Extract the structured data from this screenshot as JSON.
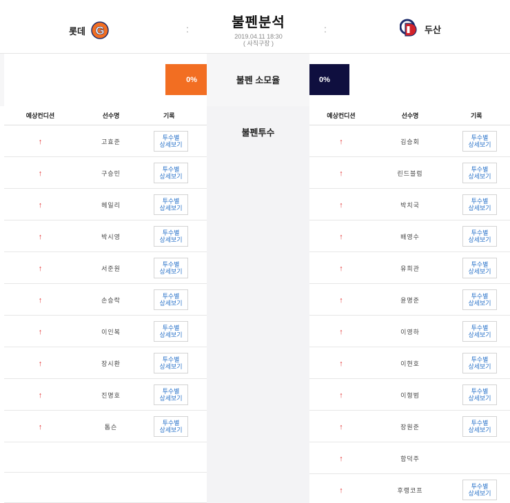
{
  "header": {
    "title": "불펜분석",
    "datetime": "2019.04.11 18:30",
    "venue": "( 사직구장 )",
    "separator": ":",
    "home": {
      "name": "롯데",
      "logo_letter": "G",
      "logo_color": "#f26e22"
    },
    "away": {
      "name": "두산",
      "logo_letter": "D",
      "logo_color": "#d3232a",
      "logo_color2": "#1c2b6b"
    }
  },
  "exhaustion": {
    "label": "불펜 소모율",
    "home_pct": "0%",
    "away_pct": "0%",
    "home_color": "#f26e22",
    "away_color": "#0f0f3f"
  },
  "center": {
    "title": "불펜투수"
  },
  "columns": {
    "condition": "예상컨디션",
    "player": "선수명",
    "record": "기록"
  },
  "detail_label_line1": "투수별",
  "detail_label_line2": "상세보기",
  "condition_arrow": "↑",
  "home_players": [
    {
      "name": "고효준"
    },
    {
      "name": "구승민"
    },
    {
      "name": "헤일리"
    },
    {
      "name": "박시영"
    },
    {
      "name": "서준원"
    },
    {
      "name": "손승락"
    },
    {
      "name": "이인복"
    },
    {
      "name": "장시환"
    },
    {
      "name": "진명호"
    },
    {
      "name": "톰슨"
    }
  ],
  "away_players": [
    {
      "name": "김승회"
    },
    {
      "name": "린드블럼"
    },
    {
      "name": "박치국"
    },
    {
      "name": "배영수"
    },
    {
      "name": "유희관"
    },
    {
      "name": "윤명준"
    },
    {
      "name": "이영하"
    },
    {
      "name": "이현호"
    },
    {
      "name": "이형범"
    },
    {
      "name": "장원준"
    },
    {
      "name": "함덕주"
    },
    {
      "name": "후랭코프"
    }
  ]
}
